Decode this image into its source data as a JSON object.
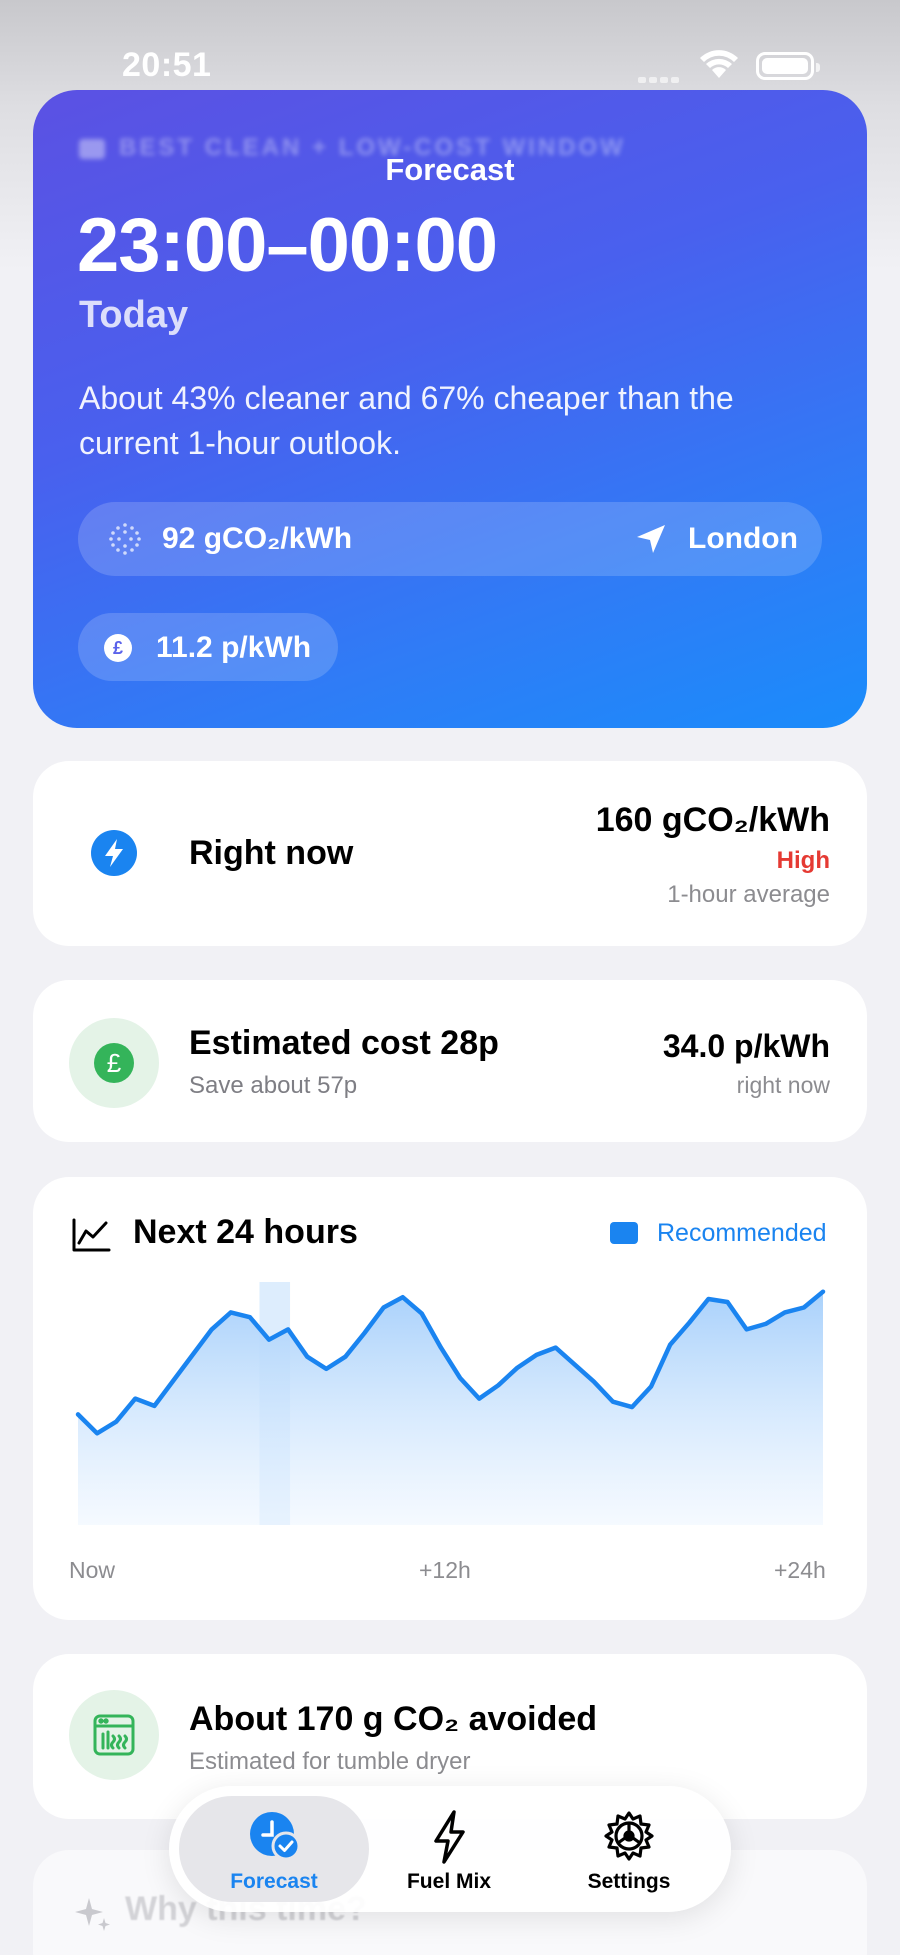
{
  "status_bar": {
    "time": "20:51"
  },
  "nav": {
    "title": "Forecast"
  },
  "hero": {
    "eyebrow": "BEST CLEAN + LOW-COST WINDOW",
    "window": "23:00–00:00",
    "day": "Today",
    "description": "About 43% cleaner and 67% cheaper than the current 1-hour outlook.",
    "carbon": "92 gCO₂/kWh",
    "location": "London",
    "price": "11.2 p/kWh",
    "icons": [
      "grid-dots-icon",
      "location-arrow-icon",
      "pound-icon"
    ]
  },
  "right_now": {
    "title": "Right now",
    "value": "160 gCO₂/kWh",
    "level": "High",
    "note": "1-hour average",
    "icon": "bolt-icon",
    "level_color": "#e53a33"
  },
  "cost": {
    "title": "Estimated cost 28p",
    "subtitle": "Save about 57p",
    "price": "34.0 p/kWh",
    "price_note": "right now",
    "icon": "pound-icon"
  },
  "chart": {
    "title": "Next 24 hours",
    "legend": "Recommended",
    "x_labels": [
      "Now",
      "+12h",
      "+24h"
    ],
    "accent": "#1a84f0",
    "points": [
      182,
      151,
      170,
      208,
      196,
      238,
      280,
      322,
      350,
      342,
      305,
      322,
      277,
      257,
      277,
      316,
      358,
      375,
      348,
      292,
      242,
      208,
      230,
      259,
      280,
      292,
      264,
      236,
      203,
      194,
      228,
      297,
      333,
      372,
      367,
      322,
      331,
      350,
      358,
      384
    ],
    "highlight_index": 10
  },
  "avoided": {
    "title": "About 170 g CO₂ avoided",
    "subtitle": "Estimated for tumble dryer",
    "icon": "dryer-icon"
  },
  "why": {
    "label": "Why this time?"
  },
  "tabs": [
    {
      "label": "Forecast",
      "icon": "clock-check-icon",
      "active": true
    },
    {
      "label": "Fuel Mix",
      "icon": "bolt-icon",
      "active": false
    },
    {
      "label": "Settings",
      "icon": "gear-icon",
      "active": false
    }
  ]
}
